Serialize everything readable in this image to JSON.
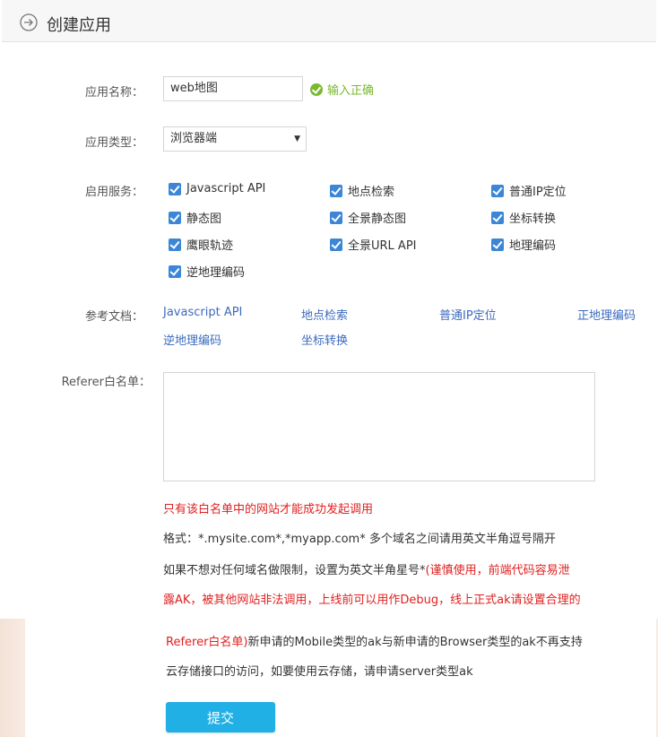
{
  "header": {
    "title": "创建应用"
  },
  "form": {
    "app_name": {
      "label": "应用名称：",
      "value": "web地图",
      "status": "输入正确"
    },
    "app_type": {
      "label": "应用类型：",
      "value": "浏览器端"
    },
    "services": {
      "label": "启用服务：",
      "items": [
        {
          "label": "Javascript API",
          "checked": true
        },
        {
          "label": "地点检索",
          "checked": true
        },
        {
          "label": "普通IP定位",
          "checked": true
        },
        {
          "label": "静态图",
          "checked": true
        },
        {
          "label": "全景静态图",
          "checked": true
        },
        {
          "label": "坐标转换",
          "checked": true
        },
        {
          "label": "鹰眼轨迹",
          "checked": true
        },
        {
          "label": "全景URL API",
          "checked": true
        },
        {
          "label": "地理编码",
          "checked": true
        },
        {
          "label": "逆地理编码",
          "checked": true
        }
      ]
    },
    "docs": {
      "label": "参考文档：",
      "links": [
        "Javascript API",
        "地点检索",
        "普通IP定位",
        "正地理编码",
        "逆地理编码",
        "坐标转换"
      ]
    },
    "referer": {
      "label": "Referer白名单：",
      "value": "",
      "note_red": "只有该白名单中的网站才能成功发起调用",
      "format": "格式：*.mysite.com*,*myapp.com* 多个域名之间请用英文半角逗号隔开",
      "line3_dark": "如果不想对任何域名做限制，设置为英文半角星号*",
      "line3_red": "(谨慎使用，前端代码容易泄",
      "line4_red": "露AK，被其他网站非法调用，上线前可以用作Debug，线上正式ak请设置合理的",
      "line5_red": "Referer白名单)",
      "line5_dark": "新申请的Mobile类型的ak与新申请的Browser类型的ak不再支持",
      "line6_dark": "云存储接口的访问，如要使用云存储，请申请server类型ak"
    },
    "submit_label": "提交"
  }
}
